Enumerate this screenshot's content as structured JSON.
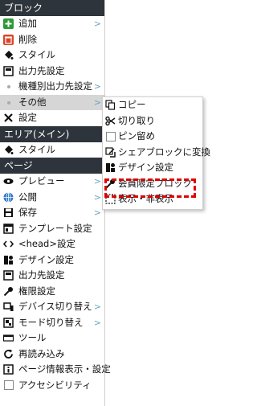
{
  "sections": {
    "block": "ブロック",
    "area": "エリア(メイン)",
    "page": "ページ"
  },
  "block_items": [
    {
      "label": "追加",
      "icon": "add-icon",
      "arrow": ">"
    },
    {
      "label": "削除",
      "icon": "trash-icon"
    },
    {
      "label": "スタイル",
      "icon": "paint-bucket-icon"
    },
    {
      "label": "出力先設定",
      "icon": "output-icon"
    },
    {
      "label": "機種別出力先設定",
      "icon": "dot",
      "arrow": ">"
    },
    {
      "label": "その他",
      "icon": "dot",
      "arrow": ">"
    },
    {
      "label": "設定",
      "icon": "tools-icon"
    }
  ],
  "area_items": [
    {
      "label": "スタイル",
      "icon": "paint-bucket-icon"
    }
  ],
  "page_items": [
    {
      "label": "プレビュー",
      "icon": "eye-icon",
      "arrow": ">"
    },
    {
      "label": "公開",
      "icon": "globe-icon",
      "arrow": ">"
    },
    {
      "label": "保存",
      "icon": "save-icon",
      "arrow": ">"
    },
    {
      "label": "テンプレート設定",
      "icon": "template-icon"
    },
    {
      "label": "<head>設定",
      "icon": "code-icon"
    },
    {
      "label": "デザイン設定",
      "icon": "design-icon"
    },
    {
      "label": "出力先設定",
      "icon": "output-icon"
    },
    {
      "label": "権限設定",
      "icon": "key-icon"
    },
    {
      "label": "デバイス切り替え",
      "icon": "device-icon",
      "arrow": ">"
    },
    {
      "label": "モード切り替え",
      "icon": "mode-icon",
      "arrow": ">"
    },
    {
      "label": "ツール",
      "icon": "toolbar-icon"
    },
    {
      "label": "再読み込み",
      "icon": "reload-icon"
    },
    {
      "label": "ページ情報表示・設定",
      "icon": "info-icon"
    },
    {
      "label": "アクセシビリティ",
      "icon": "checkbox-icon"
    }
  ],
  "submenu_items": [
    {
      "label": "コピー",
      "icon": "copy-icon"
    },
    {
      "label": "切り取り",
      "icon": "scissors-icon"
    },
    {
      "label": "ピン留め",
      "icon": "checkbox-icon"
    },
    {
      "label": "シェアブロックに変換",
      "icon": "share-icon"
    },
    {
      "label": "デザイン設定",
      "icon": "design-icon"
    },
    {
      "label": "会員限定ブロック",
      "icon": "key-icon"
    },
    {
      "label": "表示・非表示",
      "icon": "visibility-icon"
    }
  ],
  "colors": {
    "header_bg": "#2e343b",
    "highlight_bg": "#d6d6d6",
    "arrow": "#6aa6c6",
    "annotation": "#e00000"
  }
}
